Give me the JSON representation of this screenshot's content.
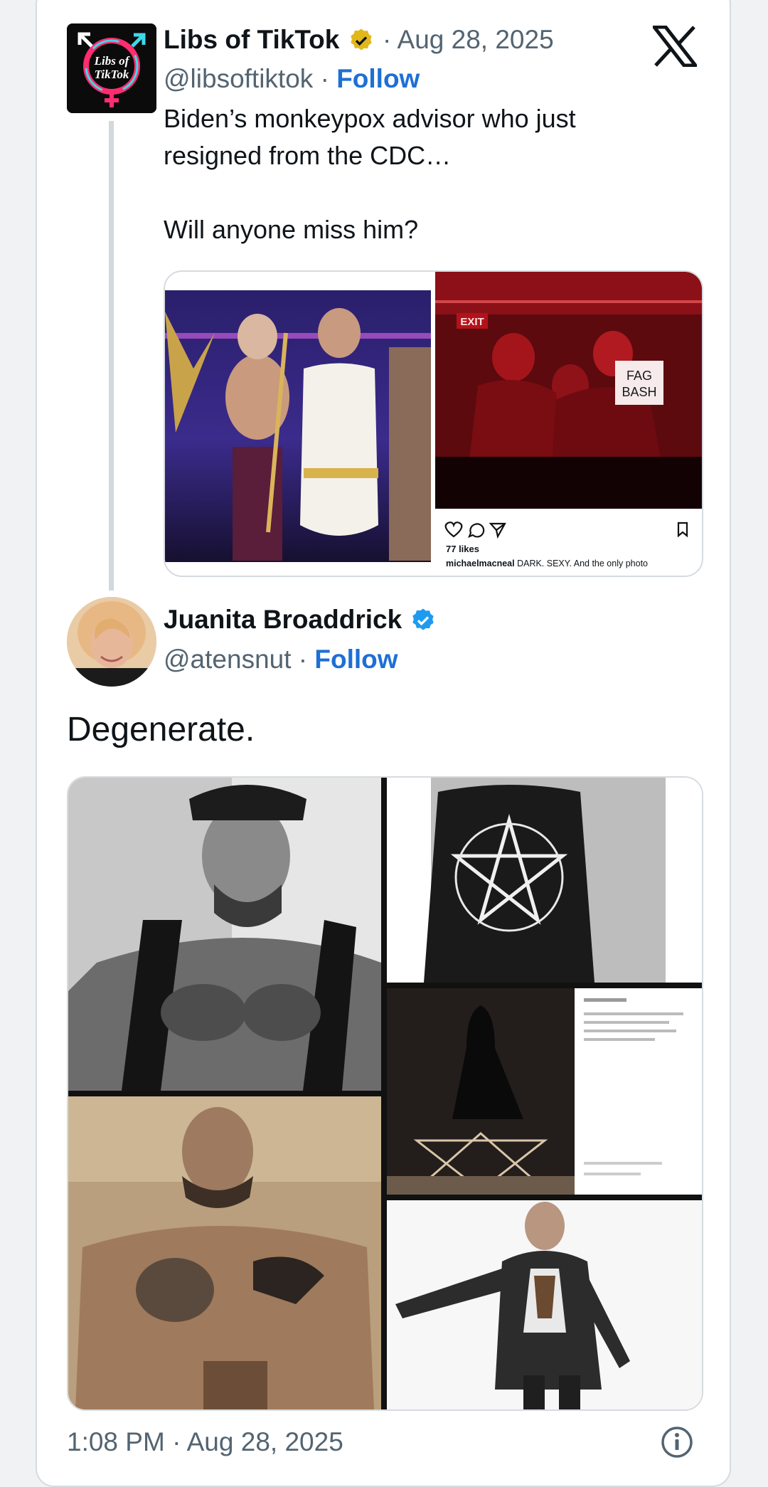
{
  "quoted_tweet": {
    "author_name": "Libs of TikTok",
    "separator_date": "·",
    "date": "Aug 28, 2025",
    "handle": "@libsoftiktok",
    "separator_follow": "·",
    "follow_label": "Follow",
    "text": "Biden’s monkeypox advisor who just\nresigned from the CDC…\n\nWill anyone miss him?",
    "avatar_text_line1": "Libs of",
    "avatar_text_line2": "TikTok",
    "embedded_post": {
      "exit_sign": "EXIT",
      "sign_text_line1": "FAG",
      "sign_text_line2": "BASH",
      "likes": "77 likes",
      "caption_user": "michaelmacneal",
      "caption_text": "DARK. SEXY. And the only photo"
    }
  },
  "reply_tweet": {
    "author_name": "Juanita Broaddrick",
    "handle": "@atensnut",
    "separator_follow": "·",
    "follow_label": "Follow",
    "text": "Degenerate."
  },
  "footer": {
    "timestamp": "1:08 PM · Aug 28, 2025"
  },
  "icons": {
    "verified_gold": "verified-gold-badge-icon",
    "verified_blue": "verified-blue-badge-icon",
    "x_logo": "x-logo-icon",
    "info": "info-icon"
  },
  "colors": {
    "follow_link": "#1d6fd6",
    "muted_text": "#536471",
    "verified_gold": "#e2b719",
    "verified_blue": "#1d9bf0"
  }
}
